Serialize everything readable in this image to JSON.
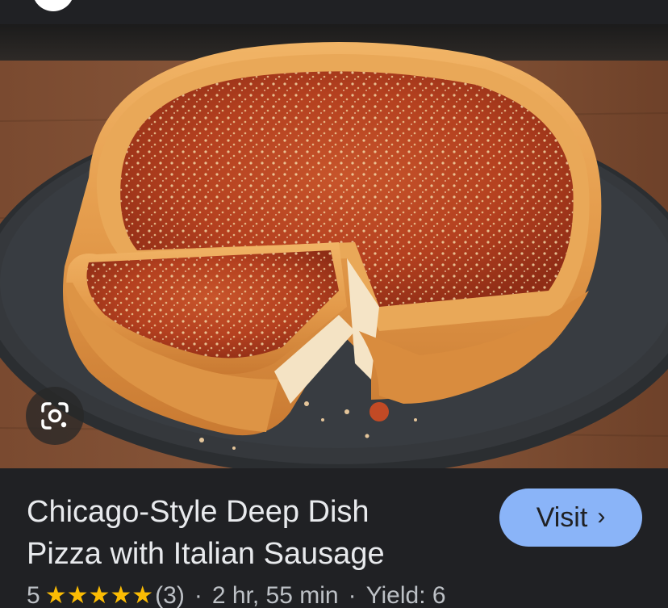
{
  "result": {
    "title_line1": "Chicago-Style Deep Dish",
    "title_line2": "Pizza with Italian Sausage",
    "visit_label": "Visit",
    "visit_chevron": "›",
    "rating_value": "5",
    "stars": "★★★★★",
    "review_count": "(3)",
    "separator": "·",
    "duration": "2 hr, 55 min",
    "yield": "Yield: 6"
  },
  "image": {
    "subject": "deep dish pizza on slate board"
  },
  "icons": {
    "lens": "google-lens-icon",
    "visit_chevron": "chevron-right-icon"
  },
  "colors": {
    "background": "#202124",
    "visit_button": "#8ab4f8",
    "stars": "#fbbc04",
    "title_text": "#e8eaed",
    "meta_text": "#bdc1c6"
  }
}
